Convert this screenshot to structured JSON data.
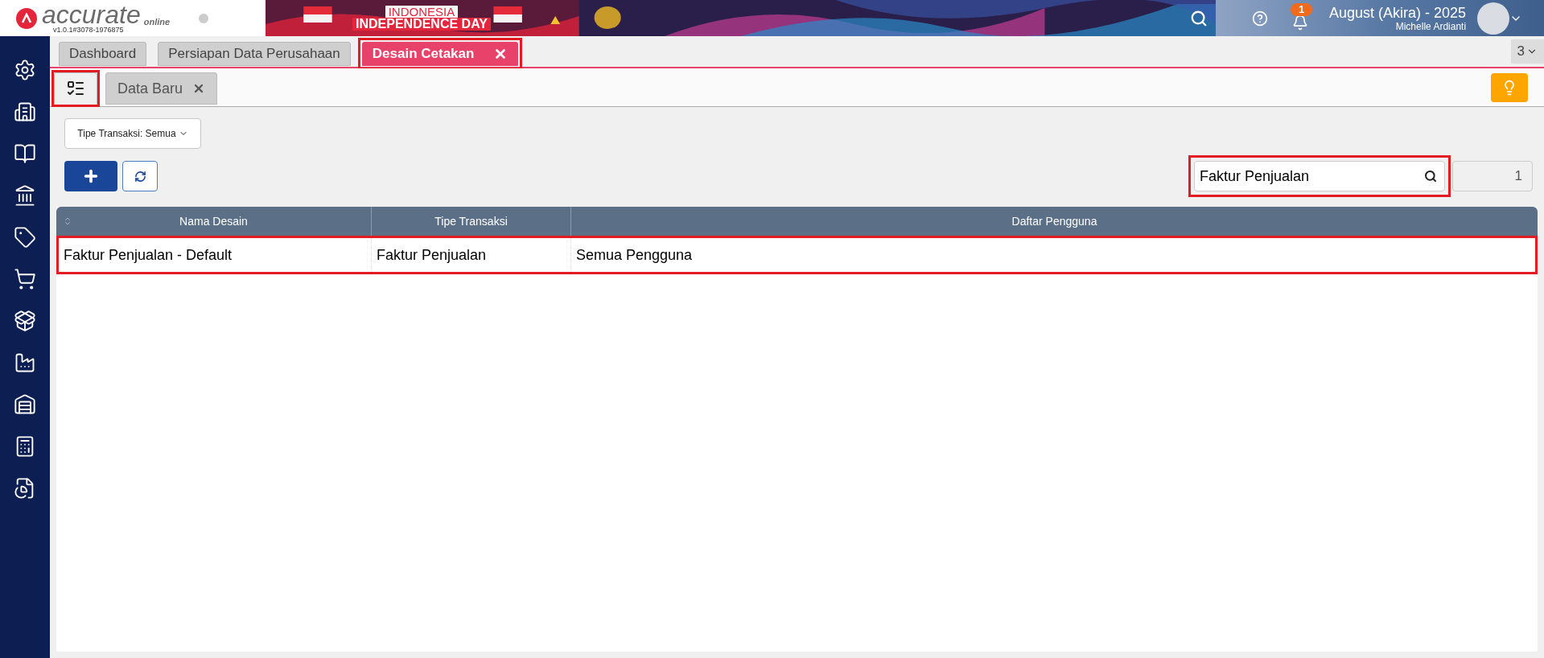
{
  "header": {
    "logo": "accurate",
    "logo_sub": "online",
    "version": "v1.0.1#3078-1976875",
    "banner_line1": "INDONESIA",
    "banner_line2": "INDEPENDENCE DAY",
    "notification_count": "1",
    "period": "August (Akira) - 2025",
    "user": "Michelle Ardianti"
  },
  "tabs": [
    {
      "label": "Dashboard",
      "selected": false,
      "closable": false,
      "highlighted": false
    },
    {
      "label": "Persiapan Data Perusahaan",
      "selected": false,
      "closable": false,
      "highlighted": false
    },
    {
      "label": "Desain Cetakan",
      "selected": true,
      "closable": true,
      "highlighted": true
    }
  ],
  "tab_count": "3",
  "subtabs": [
    {
      "kind": "list",
      "selected": true,
      "highlighted": true
    },
    {
      "kind": "text",
      "label": "Data Baru",
      "selected": false,
      "highlighted": false
    }
  ],
  "filter": {
    "label": "Tipe Transaksi: Semua"
  },
  "search": {
    "value": "Faktur Penjualan",
    "highlighted": true
  },
  "record_count": "1",
  "table": {
    "columns": [
      {
        "label": "Nama Desain",
        "sortable": true
      },
      {
        "label": "Tipe Transaksi",
        "sortable": false
      },
      {
        "label": "Daftar Pengguna",
        "sortable": false
      }
    ],
    "rows": [
      {
        "cells": [
          "Faktur Penjualan - Default",
          "Faktur Penjualan",
          "Semua Pengguna"
        ],
        "highlighted": true
      }
    ]
  }
}
